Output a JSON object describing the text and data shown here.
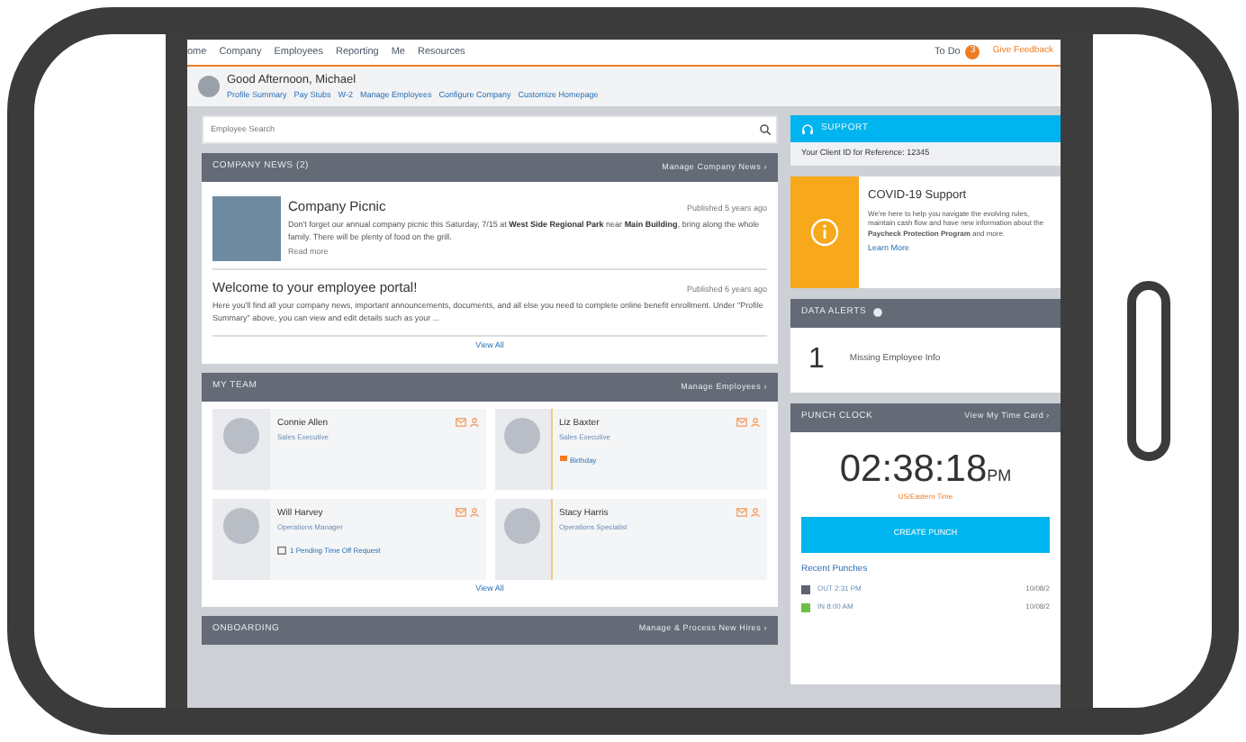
{
  "nav": {
    "links": [
      {
        "label": "ome",
        "selected": false
      },
      {
        "label": "Company",
        "selected": false
      },
      {
        "label": "Employees",
        "selected": false
      },
      {
        "label": "Reporting",
        "selected": false
      },
      {
        "label": "Me",
        "selected": false
      },
      {
        "label": "Resources",
        "selected": false
      }
    ],
    "todo": {
      "label": "To Do",
      "count": "3"
    },
    "feedback": "Give Feedback"
  },
  "header": {
    "greeting": "Good Afternoon, Michael",
    "links": [
      "Profile Summary",
      "Pay Stubs",
      "W-2",
      "Manage Employees",
      "Configure Company",
      "Customize Homepage"
    ]
  },
  "search": {
    "placeholder": "Employee Search"
  },
  "company_news": {
    "title": "COMPANY NEWS (2)",
    "action": "Manage Company News ›",
    "view_all": "View All",
    "items": [
      {
        "kind": "photo",
        "title": "Company Picnic",
        "published": "Published 5 years ago",
        "text": "Don't forget our annual company picnic this Saturday, 7/15 at **West Side Regional Park** near **Main Building**, bring along the whole family. There will be plenty of food on the grill.",
        "more": "Read more"
      },
      {
        "kind": "text",
        "title": "Welcome to your employee portal!",
        "published": "Published 6 years ago",
        "text": "Here you'll find all your company news, important announcements, documents, and all else you need to complete online benefit enrollment. Under \"Profile Summary\" above, you can view and edit details such as your ..."
      }
    ]
  },
  "my_team": {
    "title": "MY TEAM",
    "action": "Manage Employees ›",
    "view_all": "View All",
    "members": [
      {
        "name": "Connie Allen",
        "role": "Sales Executive",
        "kind": "plain",
        "highlighted": false
      },
      {
        "name": "Liz Baxter",
        "role": "Sales Executive",
        "kind": "birthday",
        "note": "Birthday",
        "highlighted": true
      },
      {
        "name": "Will Harvey",
        "role": "Operations Manager",
        "kind": "request",
        "note": "1 Pending Time Off Request",
        "highlighted": false
      },
      {
        "name": "Stacy Harris",
        "role": "Operations Specialist",
        "kind": "plain",
        "highlighted": true
      }
    ]
  },
  "onboarding": {
    "title": "ONBOARDING",
    "action": "Manage & Process New Hires ›"
  },
  "support": {
    "title": "SUPPORT",
    "client_id": "Your Client ID for Reference: 12345"
  },
  "covid": {
    "title": "COVID-19 Support",
    "text": "We're here to help you navigate the evolving rules, maintain cash flow and have new information about the **Paycheck Protection Program** and more.",
    "link": "Learn More"
  },
  "data_alerts": {
    "title": "DATA ALERTS",
    "count": "1",
    "label": "Missing Employee Info"
  },
  "punch_clock": {
    "title": "PUNCH CLOCK",
    "action": "View My Time Card ›",
    "time": "02:38:18",
    "ampm": "PM",
    "zone": "US/Eastern Time",
    "button": "CREATE PUNCH",
    "recent_title": "Recent Punches",
    "punches": [
      {
        "label": "OUT 2:31 PM",
        "date": "10/08/2",
        "color": "#5f6470"
      },
      {
        "label": "IN 8:00 AM",
        "date": "10/08/2",
        "color": "#6cc04a"
      }
    ]
  }
}
